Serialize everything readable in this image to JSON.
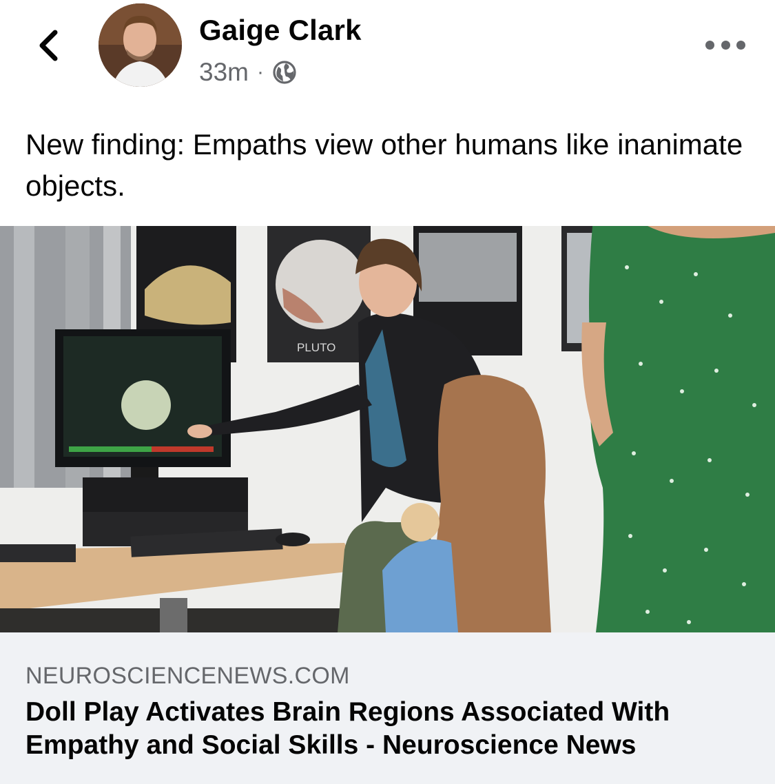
{
  "post": {
    "author": "Gaige Clark",
    "time": "33m",
    "separator": "·",
    "privacy_icon": "globe-icon",
    "caption": "New finding: Empaths view other humans like inanimate objects."
  },
  "header": {
    "back_icon": "chevron-left-icon",
    "more_icon": "more-horizontal-icon"
  },
  "photo": {
    "poster_label": "PLUTO"
  },
  "link": {
    "domain": "NEUROSCIENCENEWS.COM",
    "title": "Doll Play Activates Brain Regions Associated With Empathy and Social Skills - Neuroscience News"
  },
  "colors": {
    "text_primary": "#050505",
    "text_secondary": "#65676b",
    "card_background": "#f0f2f5"
  }
}
